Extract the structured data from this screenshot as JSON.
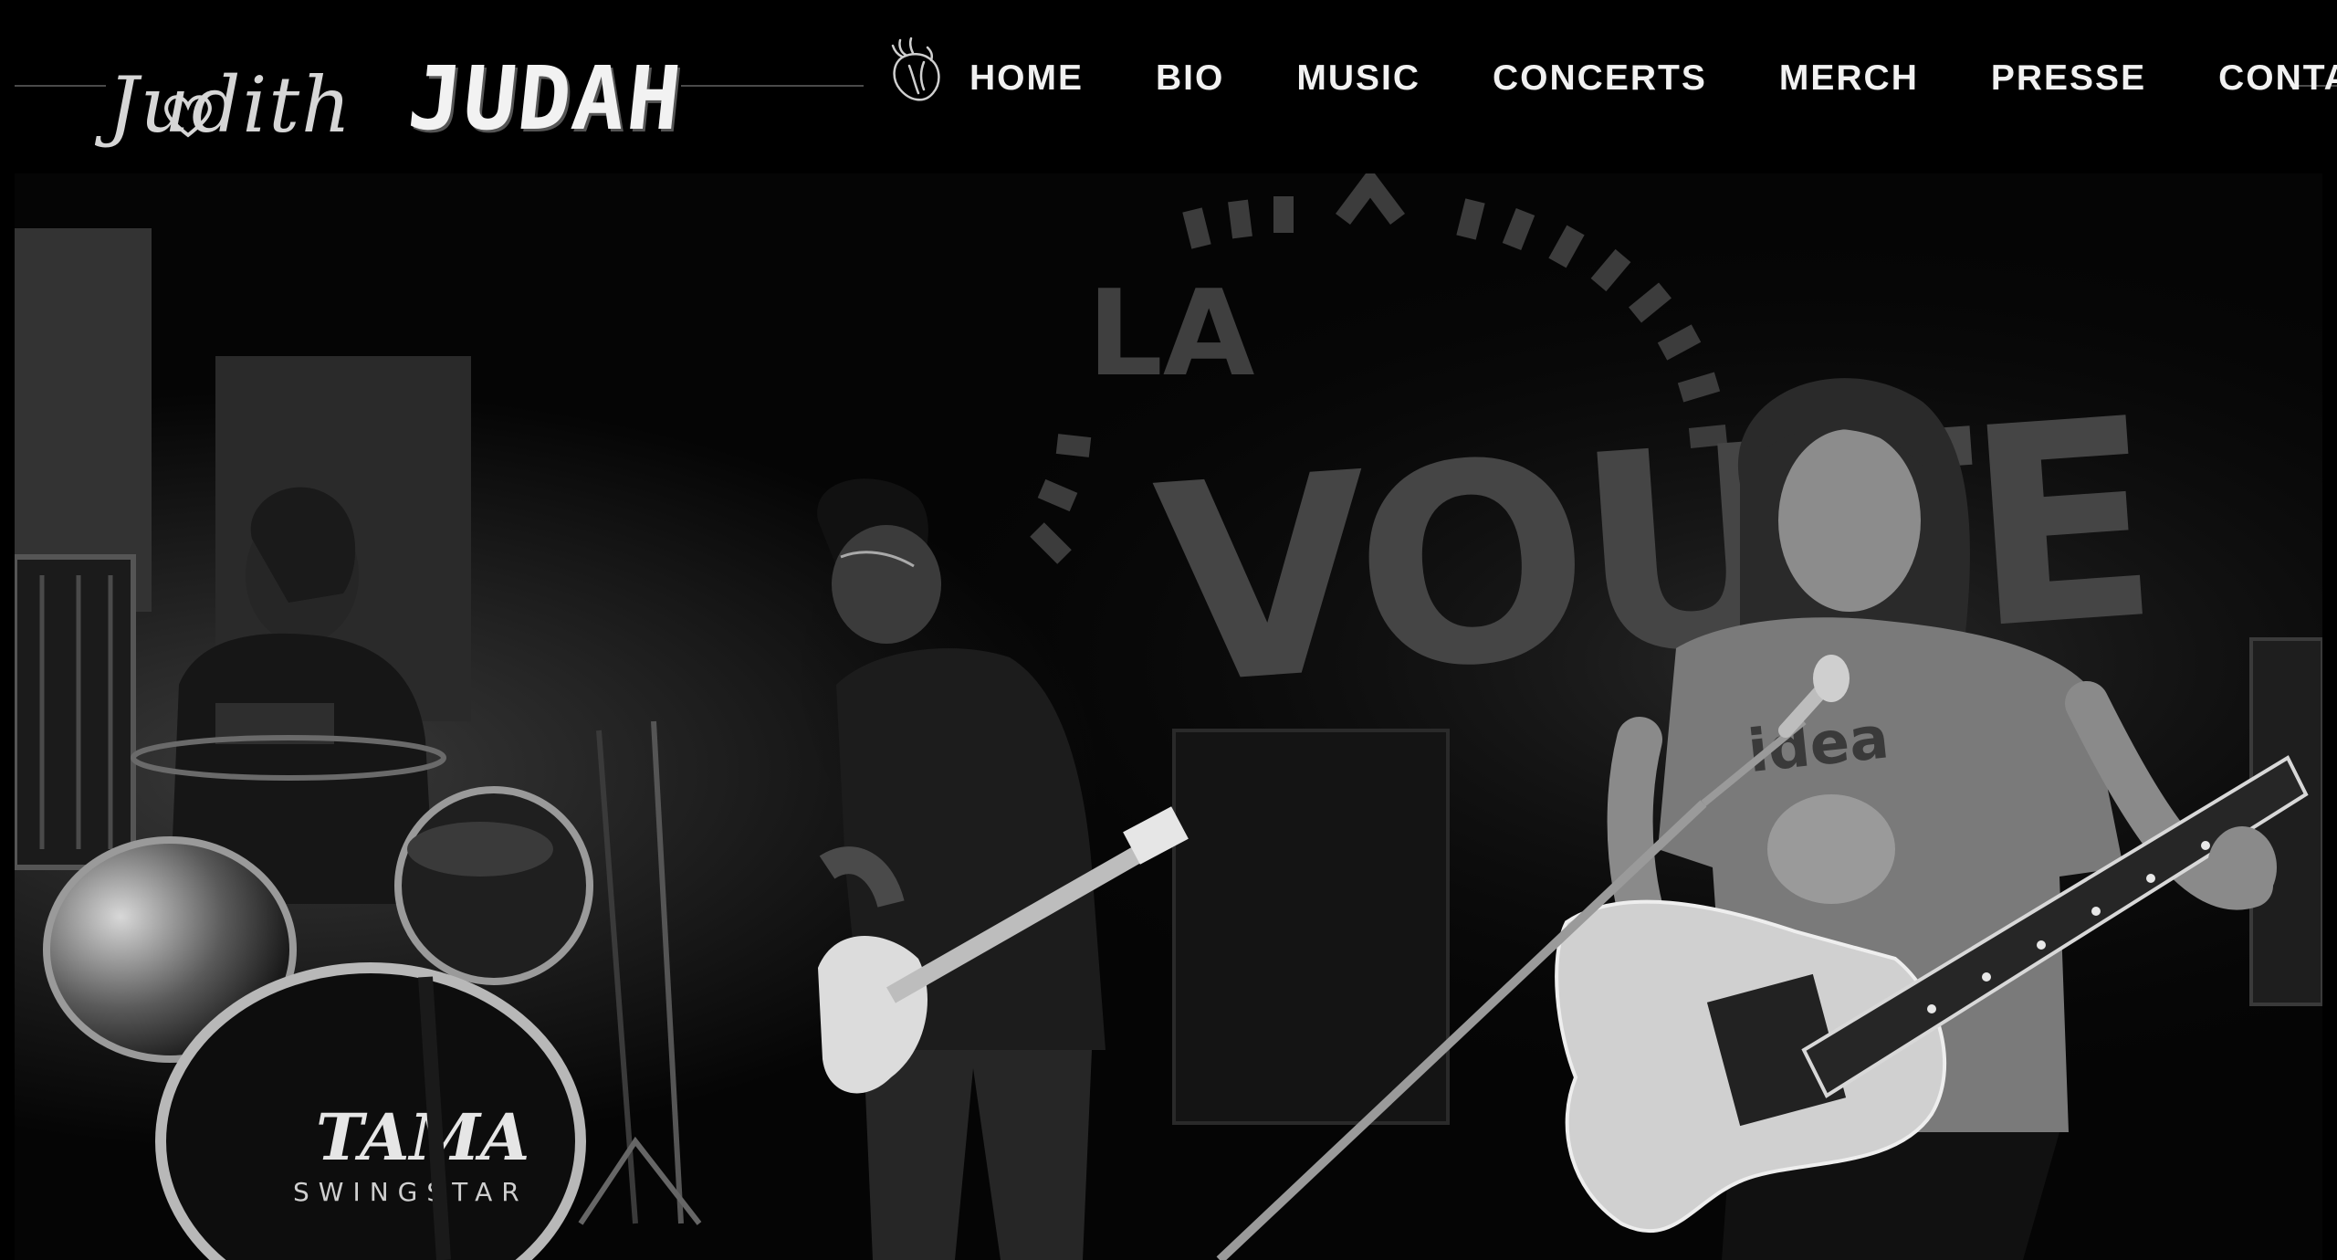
{
  "header": {
    "logo": {
      "first_name": "Judith",
      "last_name": "JUDAH"
    },
    "nav": {
      "items": [
        {
          "label": "HOME"
        },
        {
          "label": "BIO"
        },
        {
          "label": "MUSIC"
        },
        {
          "label": "CONCERTS"
        },
        {
          "label": "MERCH"
        },
        {
          "label": "PRESSE"
        },
        {
          "label": "CONTACT"
        }
      ]
    },
    "icons": {
      "decoration": "anatomical-heart-icon"
    }
  },
  "hero": {
    "backdrop_sign": {
      "line1": "LA",
      "line2": "VOUTE"
    },
    "drum_brand": {
      "line1": "TAMA",
      "line2": "SWINGSTAR"
    },
    "tshirt_print": "idea"
  },
  "colors": {
    "background": "#000000",
    "nav_text": "#f1f1f1",
    "divider": "#4a4a4a"
  }
}
